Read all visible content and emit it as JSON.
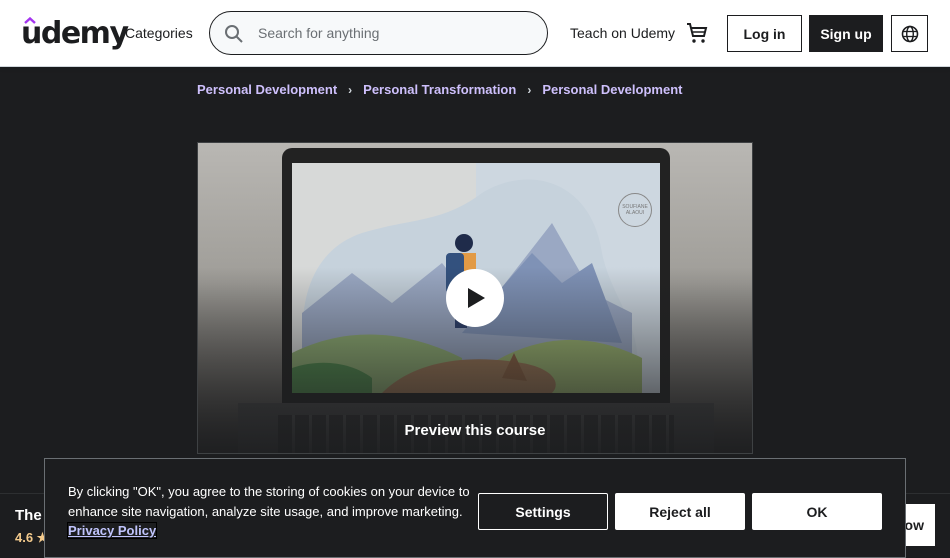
{
  "header": {
    "logo_text": "udemy",
    "categories_label": "Categories",
    "search": {
      "placeholder": "Search for anything",
      "value": ""
    },
    "teach_label": "Teach on Udemy",
    "login_label": "Log in",
    "signup_label": "Sign up",
    "icons": {
      "search": "search-icon",
      "cart": "cart-icon",
      "language": "globe-icon"
    }
  },
  "breadcrumb": {
    "items": [
      {
        "label": "Personal Development"
      },
      {
        "label": "Personal Transformation"
      },
      {
        "label": "Personal Development"
      }
    ],
    "separator": "›"
  },
  "preview": {
    "label": "Preview this course",
    "watermark": "SOUFIANE ALAOUI"
  },
  "sticky_bar": {
    "title": "The",
    "rating": "4.6 ★",
    "button_label": "ow"
  },
  "cookie_banner": {
    "text": "By clicking \"OK\", you agree to the storing of cookies on your device to enhance site navigation, analyze site usage, and improve marketing.",
    "link_label": "Privacy Policy",
    "settings_label": "Settings",
    "reject_label": "Reject all",
    "ok_label": "OK"
  },
  "colors": {
    "brand_purple": "#a435f0",
    "dark_bg": "#1c1d1f",
    "link_purple": "#cec0fc",
    "rating_gold": "#f3ca8c"
  }
}
